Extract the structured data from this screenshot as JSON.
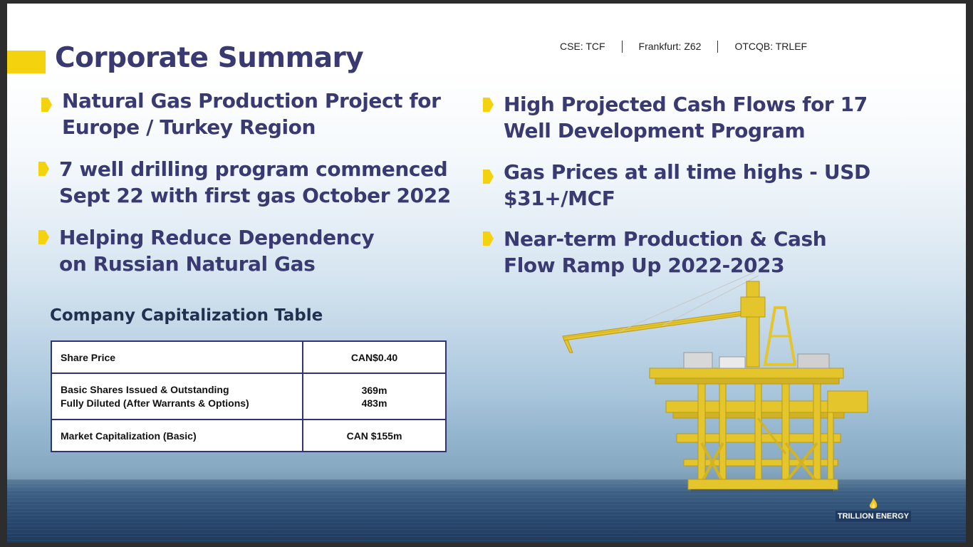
{
  "header": {
    "title": "Corporate Summary",
    "tickers": [
      "CSE: TCF",
      "Frankfurt: Z62",
      "OTCQB: TRLEF"
    ]
  },
  "bullets_left": [
    {
      "line1": "Natural Gas Production Project for",
      "line2": "Europe / Turkey Region"
    },
    {
      "line1": "7 well drilling program commenced",
      "line2": "Sept 22 with first gas October 2022"
    },
    {
      "line1": "Helping Reduce Dependency",
      "line2": "on Russian Natural Gas"
    }
  ],
  "bullets_right": [
    {
      "line1": "High Projected Cash Flows for 17",
      "line2": "Well Development Program"
    },
    {
      "line1": "Gas Prices at all time highs - USD",
      "line2": "$31+/MCF"
    },
    {
      "line1": "Near-term Production & Cash",
      "line2": "Flow Ramp Up 2022-2023"
    }
  ],
  "capitalization": {
    "title": "Company Capitalization Table",
    "rows": [
      {
        "label1": "Share Price",
        "label2": "",
        "value1": "CAN$0.40",
        "value2": ""
      },
      {
        "label1": "Basic Shares Issued & Outstanding",
        "label2": "Fully Diluted (After Warrants & Options)",
        "value1": "369m",
        "value2": "483m"
      },
      {
        "label1": "Market Capitalization (Basic)",
        "label2": "",
        "value1": "CAN $155m",
        "value2": ""
      }
    ]
  },
  "logo": {
    "text": "TRILLION ENERGY"
  },
  "colors": {
    "accent_yellow": "#f5d20e",
    "title_navy": "#3a3a72",
    "table_border": "#2f3477",
    "sea": "#2c4c72"
  },
  "icons": {
    "bullet": "yellow-chevron-icon",
    "platform": "offshore-platform-image",
    "logo": "flame-icon"
  }
}
